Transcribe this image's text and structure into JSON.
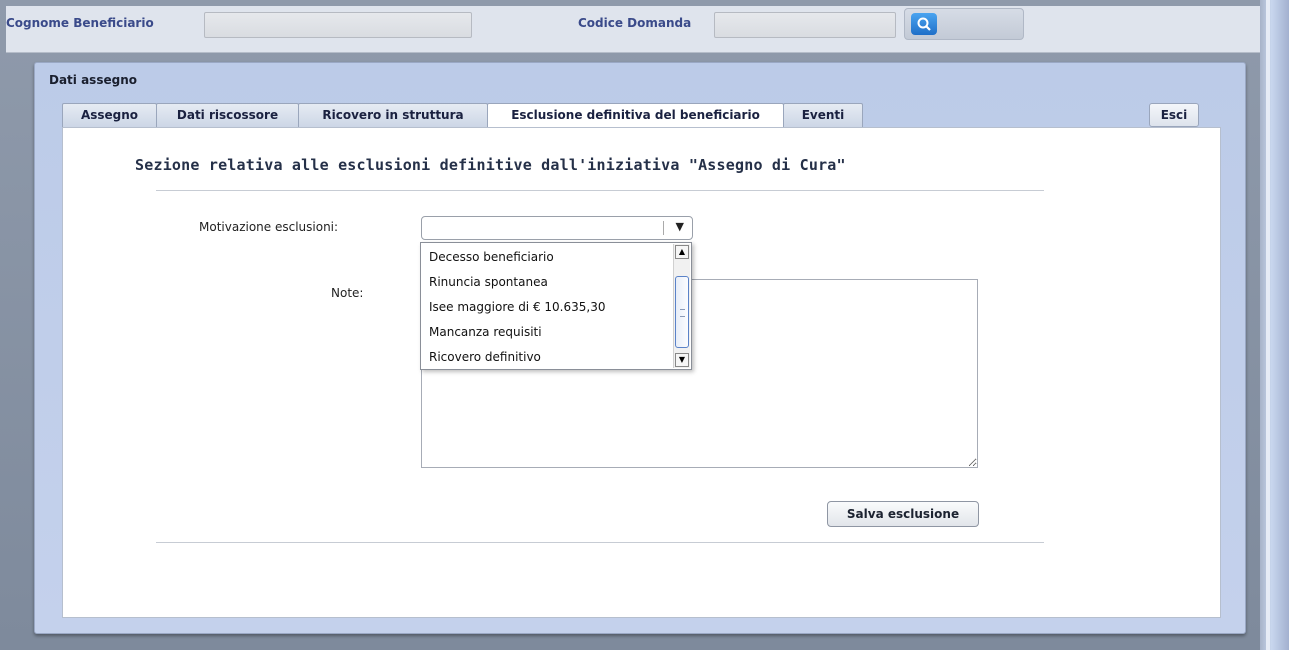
{
  "search": {
    "surname_label": "Cognome Beneficiario",
    "surname_value": "",
    "code_label": "Codice Domanda",
    "code_value": ""
  },
  "panel": {
    "title": "Dati assegno",
    "tabs": [
      {
        "label": "Assegno",
        "active": false
      },
      {
        "label": "Dati riscossore",
        "active": false
      },
      {
        "label": "Ricovero in struttura",
        "active": false
      },
      {
        "label": "Esclusione definitiva del beneficiario",
        "active": true
      },
      {
        "label": "Eventi",
        "active": false
      }
    ],
    "exit_label": "Esci"
  },
  "form": {
    "heading": "Sezione relativa alle esclusioni definitive dall'iniziativa \"Assegno di Cura\"",
    "reason_label": "Motivazione esclusioni:",
    "reason_value": "",
    "notes_label": "Note:",
    "notes_value": "",
    "save_label": "Salva esclusione"
  },
  "dropdown": {
    "options": [
      "Decesso beneficiario",
      "Rinuncia spontanea",
      "Isee maggiore di € 10.635,30",
      "Mancanza requisiti",
      "Ricovero definitivo"
    ]
  },
  "icons": {
    "search": "search-icon",
    "select_arrow": "chevron-down-icon"
  }
}
